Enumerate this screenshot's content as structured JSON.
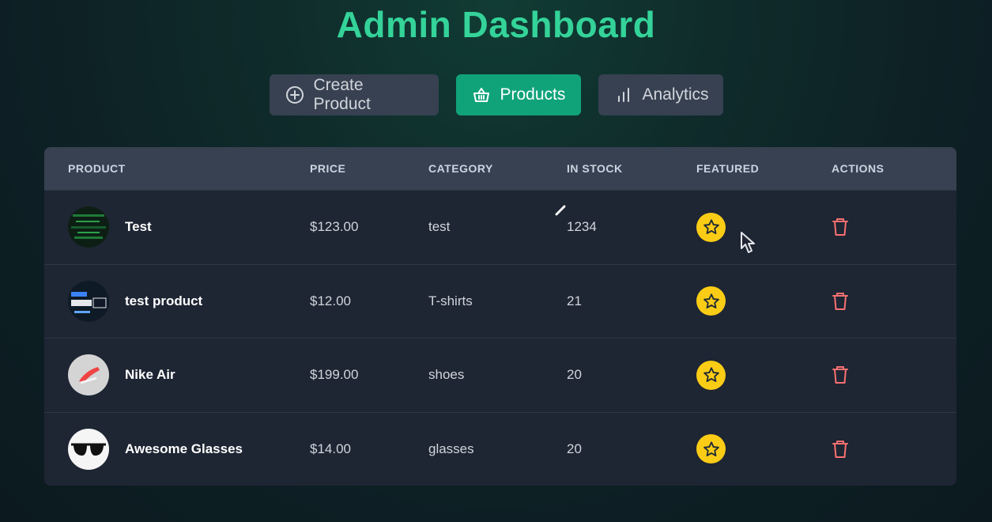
{
  "page": {
    "title": "Admin Dashboard"
  },
  "tabs": [
    {
      "label": "Create Product",
      "icon": "plus-circle-icon",
      "active": false
    },
    {
      "label": "Products",
      "icon": "basket-icon",
      "active": true
    },
    {
      "label": "Analytics",
      "icon": "bar-chart-icon",
      "active": false
    }
  ],
  "table": {
    "headers": [
      "PRODUCT",
      "PRICE",
      "CATEGORY",
      "IN STOCK",
      "FEATURED",
      "ACTIONS"
    ],
    "rows": [
      {
        "name": "Test",
        "price": "$123.00",
        "category": "test",
        "stock": "1234",
        "featured": true
      },
      {
        "name": "test product",
        "price": "$12.00",
        "category": "T-shirts",
        "stock": "21",
        "featured": true
      },
      {
        "name": "Nike Air",
        "price": "$199.00",
        "category": "shoes",
        "stock": "20",
        "featured": true
      },
      {
        "name": "Awesome Glasses",
        "price": "$14.00",
        "category": "glasses",
        "stock": "20",
        "featured": true
      }
    ]
  },
  "colors": {
    "accent": "#34d399",
    "active_tab": "#10a37a",
    "featured_star": "#facc15",
    "delete": "#f87171"
  }
}
